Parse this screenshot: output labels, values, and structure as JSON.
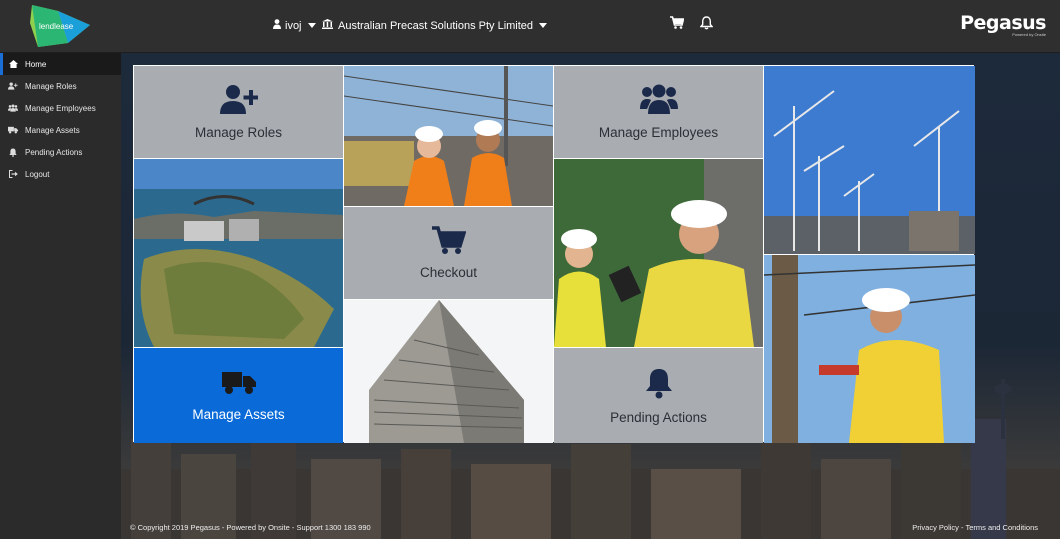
{
  "header": {
    "logo_text": "lendlease",
    "user_name": "ivoj",
    "company_name": "Australian Precast Solutions Pty Limited",
    "brand_name": "Pegasus",
    "brand_sub": "Powered by Onsite"
  },
  "sidebar": {
    "items": [
      {
        "label": "Home",
        "icon": "home-icon"
      },
      {
        "label": "Manage Roles",
        "icon": "user-plus-icon"
      },
      {
        "label": "Manage Employees",
        "icon": "users-icon"
      },
      {
        "label": "Manage Assets",
        "icon": "truck-icon"
      },
      {
        "label": "Pending Actions",
        "icon": "bell-icon"
      },
      {
        "label": "Logout",
        "icon": "logout-icon"
      }
    ]
  },
  "tiles": {
    "manage_roles": "Manage Roles",
    "manage_employees": "Manage Employees",
    "checkout": "Checkout",
    "manage_assets": "Manage Assets",
    "pending_actions": "Pending Actions"
  },
  "footer": {
    "copyright": "© Copyright 2019 Pegasus - Powered by Onsite - Support 1300 183 990",
    "privacy": "Privacy Policy",
    "separator": " - ",
    "terms": "Terms and Conditions"
  },
  "colors": {
    "accent_blue": "#0a6bd8",
    "icon_navy": "#1b2a4a",
    "tile_gray": "#a9adb1"
  }
}
